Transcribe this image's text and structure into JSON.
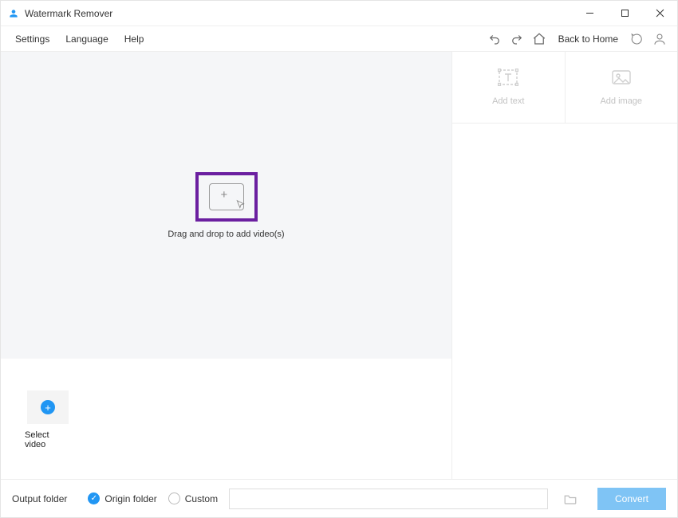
{
  "titlebar": {
    "app_name": "Watermark Remover"
  },
  "menubar": {
    "settings": "Settings",
    "language": "Language",
    "help": "Help",
    "back_home": "Back to Home"
  },
  "canvas": {
    "drop_label": "Drag and drop to add video(s)"
  },
  "select_video": {
    "label": "Select video"
  },
  "right_panel": {
    "add_text": "Add text",
    "add_image": "Add image"
  },
  "bottom": {
    "output_label": "Output folder",
    "origin_label": "Origin folder",
    "custom_label": "Custom",
    "path_value": "",
    "convert_label": "Convert"
  }
}
